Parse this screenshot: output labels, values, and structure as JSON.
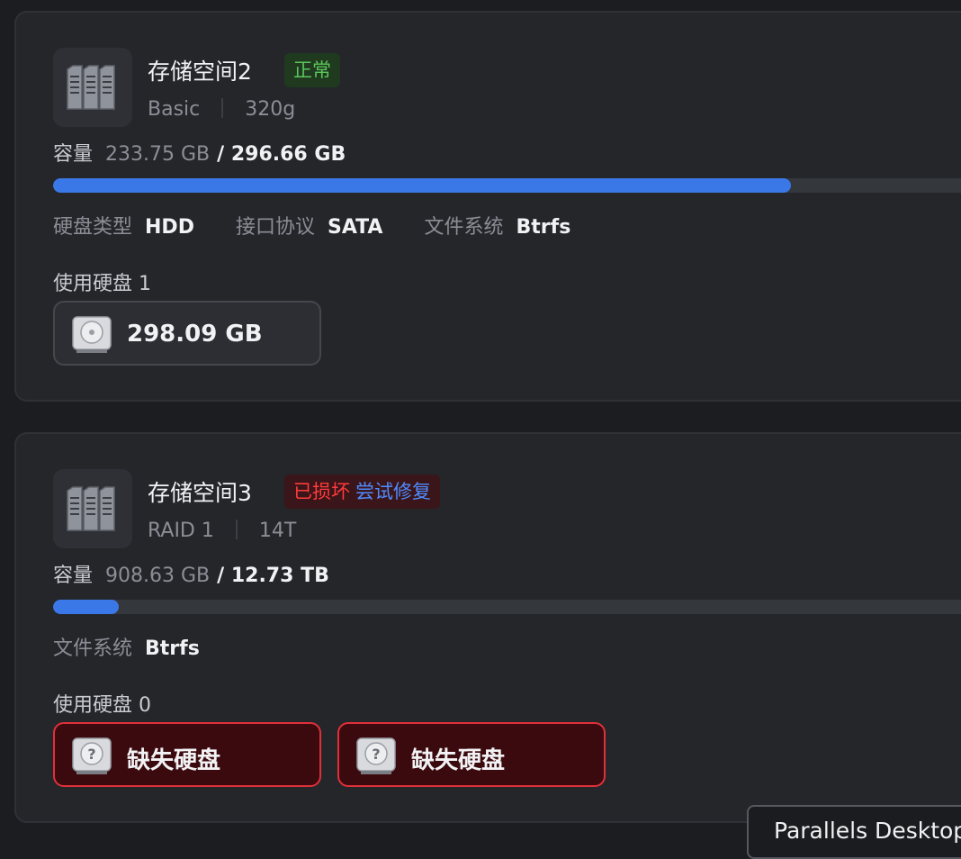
{
  "pools": [
    {
      "name": "存储空间2",
      "status": "正常",
      "raid": "Basic",
      "label": "320g",
      "capacity_label": "容量",
      "used": "233.75 GB",
      "total": "/ 296.66 GB",
      "usage_fraction": 0.788,
      "props": [
        {
          "key": "硬盘类型",
          "value": "HDD"
        },
        {
          "key": "接口协议",
          "value": "SATA"
        },
        {
          "key": "文件系统",
          "value": "Btrfs"
        }
      ],
      "disks_label": "使用硬盘 1",
      "disks": [
        {
          "label": "298.09 GB",
          "icon": "hard-drive-icon"
        }
      ]
    },
    {
      "name": "存储空间3",
      "status": "已损坏",
      "repair": "尝试修复",
      "raid": "RAID 1",
      "label": "14T",
      "capacity_label": "容量",
      "used": "908.63 GB",
      "total": "/ 12.73 TB",
      "usage_fraction": 0.07,
      "props": [
        {
          "key": "文件系统",
          "value": "Btrfs"
        }
      ],
      "disks_label": "使用硬盘 0",
      "disks": [
        {
          "label": "缺失硬盘",
          "icon": "missing-drive-icon"
        },
        {
          "label": "缺失硬盘",
          "icon": "missing-drive-icon"
        }
      ]
    }
  ],
  "tooltip": "Parallels Desktop",
  "colors": {
    "accent": "#3b78e7",
    "ok": "#5cc55c",
    "error": "#ff3b3b",
    "link": "#4f8bff"
  }
}
